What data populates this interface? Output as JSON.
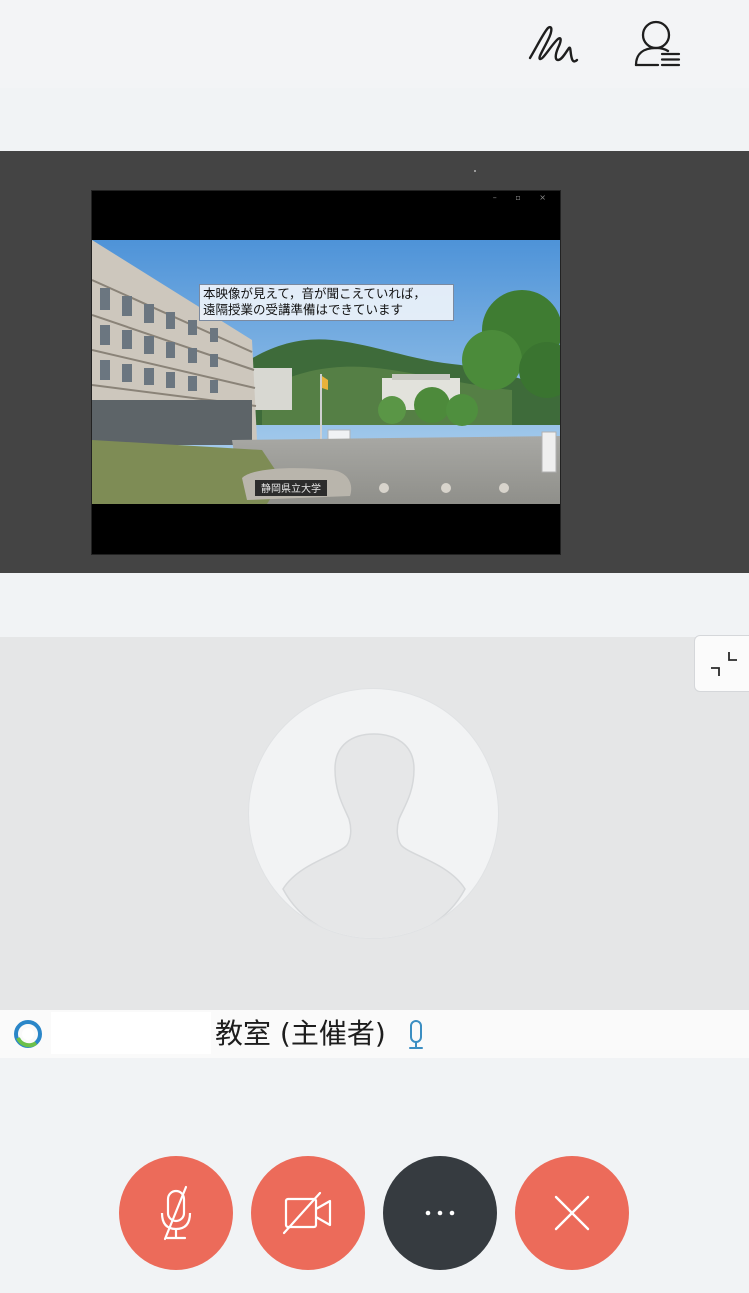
{
  "toolbar": {
    "annotate_icon": "scribble-annotate-icon",
    "participants_icon": "participants-list-icon"
  },
  "shared_content": {
    "window_controls": "–  ▫  ×",
    "caption_line1": "本映像が見えて，音が聞こえていれば，",
    "caption_line2": "遠隔授業の受講準備はできています",
    "sign_text": "静岡県立大学"
  },
  "participant": {
    "name": "教室 (主催者)",
    "avatar_icon": "default-avatar-icon",
    "mic_icon": "microphone-icon"
  },
  "controls": {
    "mute_icon": "microphone-muted-icon",
    "video_icon": "video-off-icon",
    "more_label": "···",
    "leave_icon": "close-icon"
  },
  "colors": {
    "control_red": "#ec6b5a",
    "control_dark": "#363b40",
    "mic_blue": "#3b8ec2",
    "share_background": "#444444"
  }
}
